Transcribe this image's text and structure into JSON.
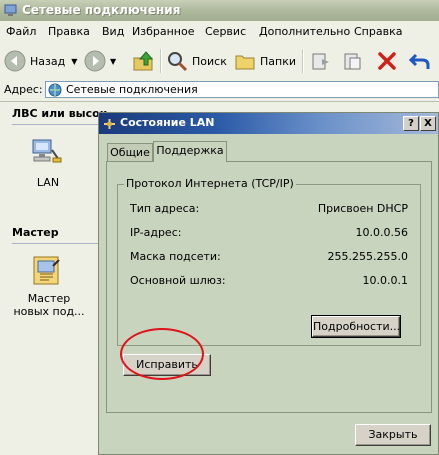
{
  "window": {
    "title": "Сетевые подключения"
  },
  "menu": {
    "items": [
      "Файл",
      "Правка",
      "Вид",
      "Избранное",
      "Сервис",
      "Дополнительно",
      "Справка"
    ]
  },
  "toolbar": {
    "back_label": "Назад",
    "search_label": "Поиск",
    "folders_label": "Папки"
  },
  "address": {
    "label": "Адрес:",
    "value": "Сетевые подключения"
  },
  "content": {
    "group_lan": "ЛВС или высок",
    "lan_icon_label": "LAN",
    "group_master": "Мастер",
    "wizard_label_line1": "Мастер",
    "wizard_label_line2": "новых под..."
  },
  "dialog": {
    "title": "Состояние LAN",
    "help_btn": "?",
    "close_btn": "X",
    "tabs": [
      "Общие",
      "Поддержка"
    ],
    "active_tab": "Поддержка",
    "group_title": "Протокол Интернета (TCP/IP)",
    "rows": [
      {
        "label": "Тип адреса:",
        "value": "Присвоен DHCP"
      },
      {
        "label": "IP-адрес:",
        "value": "10.0.0.56"
      },
      {
        "label": "Маска подсети:",
        "value": "255.255.255.0"
      },
      {
        "label": "Основной шлюз:",
        "value": "10.0.0.1"
      }
    ],
    "details_button": "Подробности...",
    "repair_button": "Исправить",
    "close_button": "Закрыть"
  },
  "colors": {
    "highlight_ellipse": "#e0121a",
    "dialog_title": "#2b5aa8"
  }
}
